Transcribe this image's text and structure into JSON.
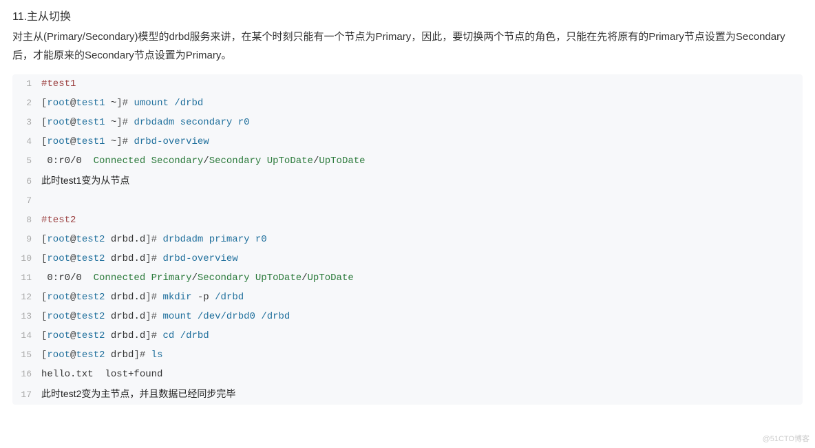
{
  "section": {
    "title": "11.主从切换",
    "desc": "对主从(Primary/Secondary)模型的drbd服务来讲，在某个时刻只能有一个节点为Primary，因此，要切换两个节点的角色，只能在先将原有的Primary节点设置为Secondary后，才能原来的Secondary节点设置为Primary。"
  },
  "code": {
    "lines": [
      {
        "n": "1",
        "tokens": [
          {
            "t": "#test1",
            "c": "tk-comment"
          }
        ]
      },
      {
        "n": "2",
        "tokens": [
          {
            "t": "[",
            "c": "tk-bracket"
          },
          {
            "t": "root",
            "c": "tk-user"
          },
          {
            "t": "@",
            "c": "tk-at"
          },
          {
            "t": "test1",
            "c": "tk-host"
          },
          {
            "t": " ~",
            "c": "tk-tilde"
          },
          {
            "t": "]",
            "c": "tk-bracket"
          },
          {
            "t": "# ",
            "c": "tk-prompt"
          },
          {
            "t": "umount",
            "c": "tk-cmd"
          },
          {
            "t": " ",
            "c": "tk-plain"
          },
          {
            "t": "/drbd",
            "c": "tk-arg"
          }
        ]
      },
      {
        "n": "3",
        "tokens": [
          {
            "t": "[",
            "c": "tk-bracket"
          },
          {
            "t": "root",
            "c": "tk-user"
          },
          {
            "t": "@",
            "c": "tk-at"
          },
          {
            "t": "test1",
            "c": "tk-host"
          },
          {
            "t": " ~",
            "c": "tk-tilde"
          },
          {
            "t": "]",
            "c": "tk-bracket"
          },
          {
            "t": "# ",
            "c": "tk-prompt"
          },
          {
            "t": "drbdadm",
            "c": "tk-cmd"
          },
          {
            "t": " ",
            "c": "tk-plain"
          },
          {
            "t": "secondary",
            "c": "tk-arg"
          },
          {
            "t": " ",
            "c": "tk-plain"
          },
          {
            "t": "r0",
            "c": "tk-arg"
          }
        ]
      },
      {
        "n": "4",
        "tokens": [
          {
            "t": "[",
            "c": "tk-bracket"
          },
          {
            "t": "root",
            "c": "tk-user"
          },
          {
            "t": "@",
            "c": "tk-at"
          },
          {
            "t": "test1",
            "c": "tk-host"
          },
          {
            "t": " ~",
            "c": "tk-tilde"
          },
          {
            "t": "]",
            "c": "tk-bracket"
          },
          {
            "t": "# ",
            "c": "tk-prompt"
          },
          {
            "t": "drbd-overview",
            "c": "tk-cmd"
          }
        ]
      },
      {
        "n": "5",
        "tokens": [
          {
            "t": " 0:r0/0  ",
            "c": "tk-plain"
          },
          {
            "t": "Connected",
            "c": "tk-conn"
          },
          {
            "t": " ",
            "c": "tk-plain"
          },
          {
            "t": "Secondary",
            "c": "tk-role"
          },
          {
            "t": "/",
            "c": "tk-slash"
          },
          {
            "t": "Secondary",
            "c": "tk-role"
          },
          {
            "t": " ",
            "c": "tk-plain"
          },
          {
            "t": "UpToDate",
            "c": "tk-state"
          },
          {
            "t": "/",
            "c": "tk-slash"
          },
          {
            "t": "UpToDate",
            "c": "tk-state"
          }
        ]
      },
      {
        "n": "6",
        "tokens": [
          {
            "t": "此时test1变为从节点",
            "c": "tk-note"
          }
        ]
      },
      {
        "n": "7",
        "tokens": [
          {
            "t": "",
            "c": "tk-plain"
          }
        ]
      },
      {
        "n": "8",
        "tokens": [
          {
            "t": "#test2",
            "c": "tk-comment"
          }
        ]
      },
      {
        "n": "9",
        "tokens": [
          {
            "t": "[",
            "c": "tk-bracket"
          },
          {
            "t": "root",
            "c": "tk-user"
          },
          {
            "t": "@",
            "c": "tk-at"
          },
          {
            "t": "test2",
            "c": "tk-host"
          },
          {
            "t": " drbd.d",
            "c": "tk-path"
          },
          {
            "t": "]",
            "c": "tk-bracket"
          },
          {
            "t": "# ",
            "c": "tk-prompt"
          },
          {
            "t": "drbdadm",
            "c": "tk-cmd"
          },
          {
            "t": " ",
            "c": "tk-plain"
          },
          {
            "t": "primary",
            "c": "tk-arg"
          },
          {
            "t": " ",
            "c": "tk-plain"
          },
          {
            "t": "r0",
            "c": "tk-arg"
          }
        ]
      },
      {
        "n": "10",
        "tokens": [
          {
            "t": "[",
            "c": "tk-bracket"
          },
          {
            "t": "root",
            "c": "tk-user"
          },
          {
            "t": "@",
            "c": "tk-at"
          },
          {
            "t": "test2",
            "c": "tk-host"
          },
          {
            "t": " drbd.d",
            "c": "tk-path"
          },
          {
            "t": "]",
            "c": "tk-bracket"
          },
          {
            "t": "# ",
            "c": "tk-prompt"
          },
          {
            "t": "drbd-overview",
            "c": "tk-cmd"
          }
        ]
      },
      {
        "n": "11",
        "tokens": [
          {
            "t": " 0:r0/0  ",
            "c": "tk-plain"
          },
          {
            "t": "Connected",
            "c": "tk-conn"
          },
          {
            "t": " ",
            "c": "tk-plain"
          },
          {
            "t": "Primary",
            "c": "tk-role"
          },
          {
            "t": "/",
            "c": "tk-slash"
          },
          {
            "t": "Secondary",
            "c": "tk-role"
          },
          {
            "t": " ",
            "c": "tk-plain"
          },
          {
            "t": "UpToDate",
            "c": "tk-state"
          },
          {
            "t": "/",
            "c": "tk-slash"
          },
          {
            "t": "UpToDate",
            "c": "tk-state"
          }
        ]
      },
      {
        "n": "12",
        "tokens": [
          {
            "t": "[",
            "c": "tk-bracket"
          },
          {
            "t": "root",
            "c": "tk-user"
          },
          {
            "t": "@",
            "c": "tk-at"
          },
          {
            "t": "test2",
            "c": "tk-host"
          },
          {
            "t": " drbd.d",
            "c": "tk-path"
          },
          {
            "t": "]",
            "c": "tk-bracket"
          },
          {
            "t": "# ",
            "c": "tk-prompt"
          },
          {
            "t": "mkdir",
            "c": "tk-cmd"
          },
          {
            "t": " ",
            "c": "tk-plain"
          },
          {
            "t": "-p",
            "c": "tk-flag"
          },
          {
            "t": " ",
            "c": "tk-plain"
          },
          {
            "t": "/drbd",
            "c": "tk-arg"
          }
        ]
      },
      {
        "n": "13",
        "tokens": [
          {
            "t": "[",
            "c": "tk-bracket"
          },
          {
            "t": "root",
            "c": "tk-user"
          },
          {
            "t": "@",
            "c": "tk-at"
          },
          {
            "t": "test2",
            "c": "tk-host"
          },
          {
            "t": " drbd.d",
            "c": "tk-path"
          },
          {
            "t": "]",
            "c": "tk-bracket"
          },
          {
            "t": "# ",
            "c": "tk-prompt"
          },
          {
            "t": "mount",
            "c": "tk-cmd"
          },
          {
            "t": " ",
            "c": "tk-plain"
          },
          {
            "t": "/dev/drbd0",
            "c": "tk-arg"
          },
          {
            "t": " ",
            "c": "tk-plain"
          },
          {
            "t": "/drbd",
            "c": "tk-arg"
          }
        ]
      },
      {
        "n": "14",
        "tokens": [
          {
            "t": "[",
            "c": "tk-bracket"
          },
          {
            "t": "root",
            "c": "tk-user"
          },
          {
            "t": "@",
            "c": "tk-at"
          },
          {
            "t": "test2",
            "c": "tk-host"
          },
          {
            "t": " drbd.d",
            "c": "tk-path"
          },
          {
            "t": "]",
            "c": "tk-bracket"
          },
          {
            "t": "# ",
            "c": "tk-prompt"
          },
          {
            "t": "cd",
            "c": "tk-cmd"
          },
          {
            "t": " ",
            "c": "tk-plain"
          },
          {
            "t": "/drbd",
            "c": "tk-arg"
          }
        ]
      },
      {
        "n": "15",
        "tokens": [
          {
            "t": "[",
            "c": "tk-bracket"
          },
          {
            "t": "root",
            "c": "tk-user"
          },
          {
            "t": "@",
            "c": "tk-at"
          },
          {
            "t": "test2",
            "c": "tk-host"
          },
          {
            "t": " drbd",
            "c": "tk-path"
          },
          {
            "t": "]",
            "c": "tk-bracket"
          },
          {
            "t": "# ",
            "c": "tk-prompt"
          },
          {
            "t": "ls",
            "c": "tk-cmd"
          }
        ]
      },
      {
        "n": "16",
        "tokens": [
          {
            "t": "hello.txt  lost+found",
            "c": "tk-plain"
          }
        ]
      },
      {
        "n": "17",
        "tokens": [
          {
            "t": "此时test2变为主节点，并且数据已经同步完毕",
            "c": "tk-note"
          }
        ]
      }
    ]
  },
  "watermark": "@51CTO博客"
}
